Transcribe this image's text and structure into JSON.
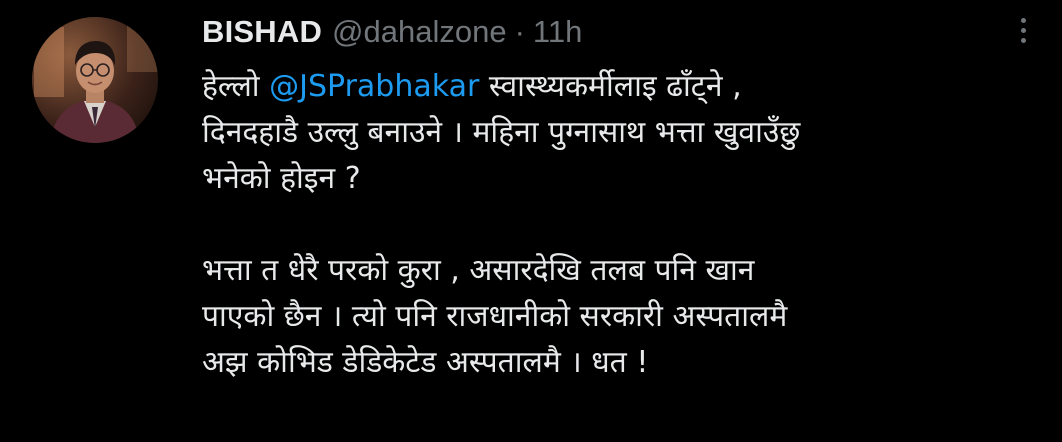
{
  "tweet": {
    "author": {
      "display_name": "BISHAD",
      "handle": "@dahalzone",
      "separator": "·",
      "time": "11h"
    },
    "menu_icon": "more-vertical-icon",
    "colors": {
      "background": "#000000",
      "text": "#e7e9ea",
      "muted": "#71767b",
      "mention": "#1d9bf0"
    },
    "paragraph1": {
      "line1_prefix": "हेल्लो ",
      "mention": "@JSPrabhakar",
      "line1_suffix": " स्वास्थ्यकर्मीलाइ ढाँट्ने ,",
      "line2": "दिनदहाडै उल्लु बनाउने । महिना पुग्नासाथ भत्ता खुवाउँछु",
      "line3": "भनेको होइन ?"
    },
    "paragraph2": {
      "line1": "भत्ता त धेरै परको कुरा , असारदेखि तलब पनि खान",
      "line2": "पाएको छैन । त्यो पनि राजधानीको सरकारी अस्पतालमै",
      "line3": "अझ कोभिड डेडिकेटेड अस्पतालमै । धत !"
    }
  }
}
